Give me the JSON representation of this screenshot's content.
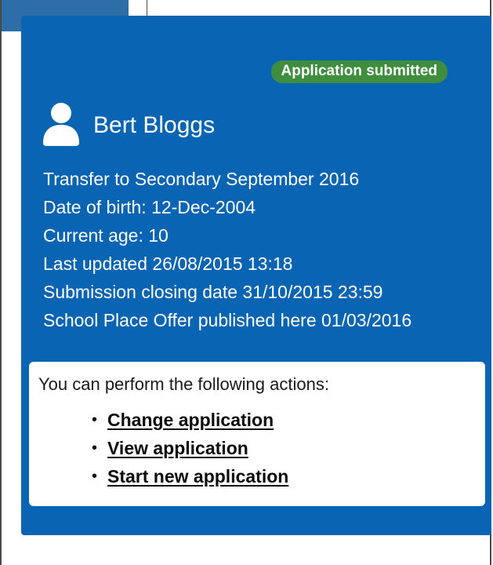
{
  "card": {
    "status_badge": "Application submitted",
    "person_name": "Bert Bloggs",
    "details": [
      "Transfer to Secondary September 2016",
      "Date of birth: 12-Dec-2004",
      "Current age: 10",
      "Last updated 26/08/2015 13:18",
      "Submission closing date 31/10/2015 23:59",
      "School Place Offer published here 01/03/2016"
    ],
    "icon": "user-icon",
    "colors": {
      "card_background": "#0965b3",
      "badge_background": "#3e8e3e",
      "text_on_card": "#ffffff"
    }
  },
  "actions": {
    "intro": "You can perform the following actions:",
    "items": [
      {
        "label": "Change application"
      },
      {
        "label": "View application"
      },
      {
        "label": "Start new application"
      }
    ]
  }
}
